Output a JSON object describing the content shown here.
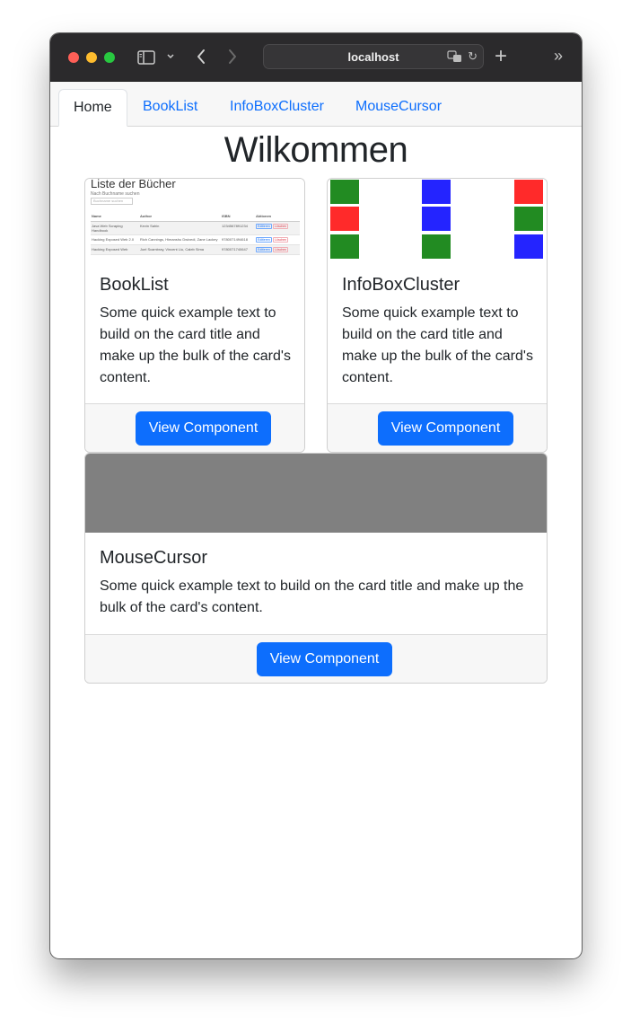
{
  "browser": {
    "url_host": "localhost"
  },
  "nav": {
    "tabs": [
      {
        "label": "Home",
        "active": true
      },
      {
        "label": "BookList",
        "active": false
      },
      {
        "label": "InfoBoxCluster",
        "active": false
      },
      {
        "label": "MouseCursor",
        "active": false
      }
    ]
  },
  "page": {
    "title": "Wilkommen"
  },
  "cards": [
    {
      "title": "BookList",
      "text": "Some quick example text to build on the card title and make up the bulk of the card's content.",
      "button": "View Component",
      "thumbnail": {
        "heading": "Liste der Bücher",
        "filter_label": "Nach Buchname suchen",
        "filter_placeholder": "Buchname suchen",
        "columns": [
          "Name",
          "Author",
          "ISBN",
          "Aktionen"
        ],
        "rows": [
          [
            "Java Web Scraping Handbook",
            "Kevin Sahin",
            "1234567891234",
            "Editieren",
            "Löschen"
          ],
          [
            "Hacking Exposed Web 2.0",
            "Rich Cannings, Himanshu Dwivedi, Zane Lackey",
            "9780071494618",
            "Editieren",
            "Löschen"
          ],
          [
            "Hacking Exposed Web",
            "Joel Scambray, Vincent Liu, Caleb Sima",
            "9780071740647",
            "Editieren",
            "Löschen"
          ]
        ]
      }
    },
    {
      "title": "InfoBoxCluster",
      "text": "Some quick example text to build on the card title and make up the bulk of the card's content.",
      "button": "View Component",
      "thumbnail": {
        "colors": {
          "green": "#228b22",
          "blue": "#2424ff",
          "red": "#ff2a2a"
        }
      }
    },
    {
      "title": "MouseCursor",
      "text": "Some quick example text to build on the card title and make up the bulk of the card's content.",
      "button": "View Component",
      "thumbnail": {
        "color": "#808080"
      }
    }
  ],
  "colors": {
    "primary": "#0d6efd",
    "footer_bg": "#f7f7f7"
  }
}
